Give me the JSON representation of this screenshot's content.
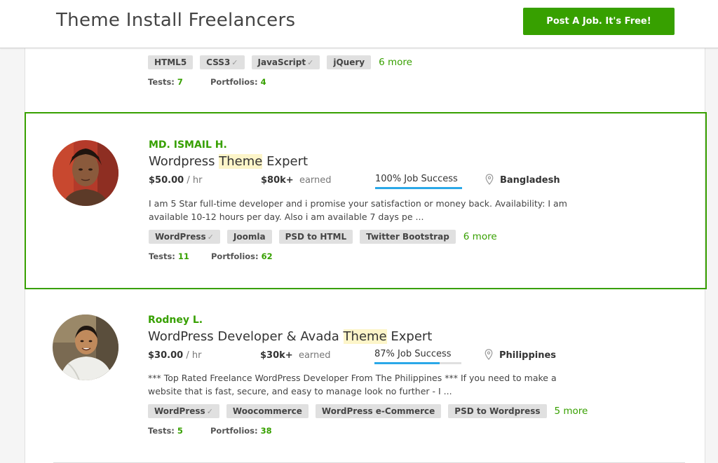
{
  "header": {
    "title": "Theme Install Freelancers",
    "post_button": "Post A Job. It's Free!"
  },
  "colors": {
    "accent": "#37a000",
    "progress": "#2aa8e8",
    "highlight": "#fdf5c9"
  },
  "top_card": {
    "tags": [
      {
        "label": "HTML5",
        "verified": false
      },
      {
        "label": "CSS3",
        "verified": true
      },
      {
        "label": "JavaScript",
        "verified": true
      },
      {
        "label": "jQuery",
        "verified": false
      }
    ],
    "more": "6 more",
    "tests_label": "Tests:",
    "tests": "7",
    "portfolios_label": "Portfolios:",
    "portfolios": "4"
  },
  "freelancers": [
    {
      "name": "MD. ISMAIL H.",
      "headline_pre": "Wordpress ",
      "headline_hl": "Theme",
      "headline_post": " Expert",
      "rate": "$50.00",
      "rate_unit": "/ hr",
      "earned": "$80k+",
      "earned_label": "earned",
      "job_success": "100% Job Success",
      "job_success_pct": 100,
      "location": "Bangladesh",
      "description": "I am 5 Star full-time developer and i promise your satisfaction or money back. Availability: I am available 10-12 hours per day. Also i am available 7 days pe ...",
      "tags": [
        {
          "label": "WordPress",
          "verified": true
        },
        {
          "label": "Joomla",
          "verified": false
        },
        {
          "label": "PSD to HTML",
          "verified": false
        },
        {
          "label": "Twitter Bootstrap",
          "verified": false
        }
      ],
      "more": "6 more",
      "tests_label": "Tests:",
      "tests": "11",
      "portfolios_label": "Portfolios:",
      "portfolios": "62"
    },
    {
      "name": "Rodney L.",
      "headline_pre": "WordPress Developer & Avada ",
      "headline_hl": "Theme",
      "headline_post": " Expert",
      "rate": "$30.00",
      "rate_unit": "/ hr",
      "earned": "$30k+",
      "earned_label": "earned",
      "job_success": "87% Job Success",
      "job_success_pct": 75,
      "location": "Philippines",
      "description": "*** Top Rated Freelance WordPress Developer From The Philippines *** If you need to make a website that is fast, secure, and easy to manage look no further - I ...",
      "tags": [
        {
          "label": "WordPress",
          "verified": true
        },
        {
          "label": "Woocommerce",
          "verified": false
        },
        {
          "label": "WordPress e-Commerce",
          "verified": false
        },
        {
          "label": "PSD to Wordpress",
          "verified": false
        }
      ],
      "more": "5 more",
      "tests_label": "Tests:",
      "tests": "5",
      "portfolios_label": "Portfolios:",
      "portfolios": "38"
    }
  ]
}
